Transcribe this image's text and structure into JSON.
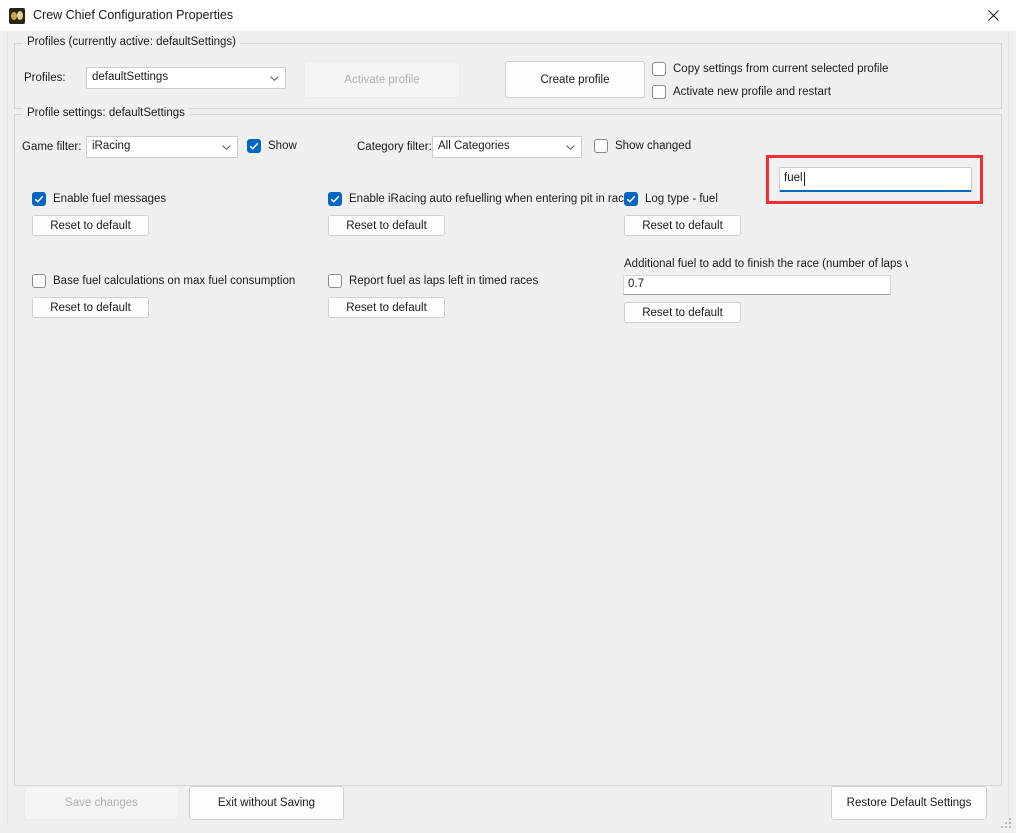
{
  "window": {
    "title": "Crew Chief Configuration Properties",
    "icon": "crew-chief-logo-icon",
    "close_icon": "close-icon"
  },
  "profiles_group": {
    "legend": "Profiles (currently active: defaultSettings)",
    "profiles_label": "Profiles:",
    "profile_selected": "defaultSettings",
    "activate_profile_button": "Activate profile",
    "activate_profile_disabled": true,
    "create_profile_button": "Create profile",
    "copy_settings_checkbox": {
      "label": "Copy settings from current selected profile",
      "checked": false
    },
    "activate_new_profile_checkbox": {
      "label": "Activate new profile and restart",
      "checked": false
    }
  },
  "settings_group": {
    "legend": "Profile settings: defaultSettings",
    "game_filter_label": "Game filter:",
    "game_filter_value": "iRacing",
    "show_checkbox": {
      "label": "Show",
      "checked": true
    },
    "category_filter_label": "Category filter:",
    "category_filter_value": "All Categories",
    "show_changed_checkbox": {
      "label": "Show changed",
      "checked": false
    },
    "search": {
      "value": "fuel",
      "placeholder": "",
      "focused": true,
      "annotation_color": "#f03030"
    },
    "reset_button_label": "Reset to default",
    "items": [
      {
        "name": "enable-fuel-messages",
        "kind": "checkbox",
        "label": "Enable fuel messages",
        "checked": true
      },
      {
        "name": "enable-iracing-auto-refuelling",
        "kind": "checkbox",
        "label": "Enable iRacing auto refuelling when entering pit in race",
        "checked": true
      },
      {
        "name": "log-type-fuel",
        "kind": "checkbox",
        "label": "Log type - fuel",
        "checked": true
      },
      {
        "name": "base-fuel-calculations-on-max-fuel-consumption",
        "kind": "checkbox",
        "label": "Base fuel calculations on max fuel consumption",
        "checked": false
      },
      {
        "name": "report-fuel-as-laps-left-in-timed-races",
        "kind": "checkbox",
        "label": "Report fuel as laps left in timed races",
        "checked": false
      },
      {
        "name": "additional-fuel-to-finish-race",
        "kind": "text",
        "label": "Additional fuel to add to finish the race (number of laps worth",
        "value": "0.7"
      }
    ]
  },
  "footer": {
    "save_changes_button": "Save changes",
    "save_changes_disabled": true,
    "exit_without_saving_button": "Exit without Saving",
    "restore_default_settings_button": "Restore Default Settings"
  },
  "colors": {
    "accent": "#0067c0",
    "window_bg": "#f0f0f0",
    "annotation": "#f03030"
  }
}
